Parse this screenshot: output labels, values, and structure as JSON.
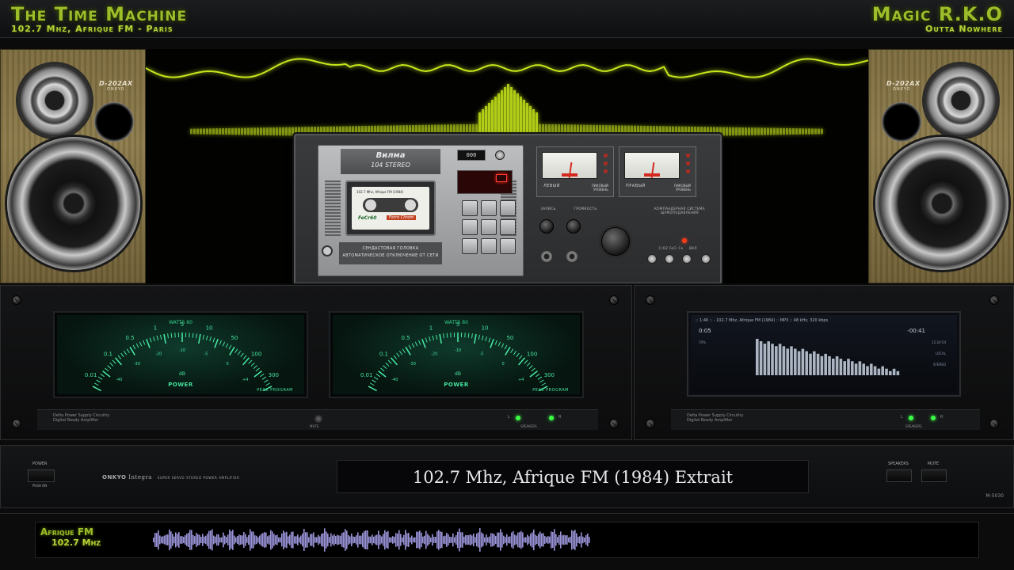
{
  "header": {
    "title_left": "The Time Machine",
    "subtitle_left": "102.7 Mhz, Afrique FM - Paris",
    "title_right": "Magic R.K.O",
    "subtitle_right": "Outta Nowhere"
  },
  "speakers": {
    "model": "D-202AX",
    "maker": "ONKYO"
  },
  "cassette_deck": {
    "brand": "Вилма",
    "model": "104 STEREO",
    "counter": "000",
    "cassette_title": "102.7 Mhz, Afrique FM (1984)",
    "cassette_type": "FeCr60",
    "cassette_label": "Ferro Chrom",
    "caption_line1": "СЕНДАСТОВАЯ ГОЛОВКА",
    "caption_line2": "АВТОМАТИЧЕСКОЕ ОТКЛЮЧЕНИЕ ОТ СЕТИ",
    "vu_left_label": "ЛЕВЫЙ",
    "vu_right_label": "ПРАВЫЙ",
    "vu_peak_label": "ПИКОВЫЙ УРОВЕНЬ",
    "label_record": "ЗАПИСЬ",
    "label_volume": "ГРОМКОСТЬ",
    "label_compander": "КОМПАНДЕРНАЯ СИСТЕМА ШУМОПОДАВЛЕНИЯ",
    "label_tape_types": "CrO2  FeCr  Fe",
    "label_on": "ВКЛ"
  },
  "amp_meters": {
    "watts_label": "WATTS 80",
    "power_label": "POWER",
    "peak_label": "PEAK PROGRAM",
    "db_label": "dB",
    "scale_top": [
      "0.01",
      "0.1",
      "0.5",
      "1",
      "5",
      "10",
      "50",
      "100",
      "300"
    ],
    "scale_bottom": [
      "-40",
      "-30",
      "-20",
      "-10",
      "-5",
      "0",
      "+4"
    ]
  },
  "amp_footer": {
    "line1": "Delta Power Supply Circuitry",
    "line2": "Digital Ready Amplifier",
    "mute": "MUTE",
    "speakers": "SPEAKERS",
    "left": "L",
    "right": "R"
  },
  "player": {
    "top_line": ":: 1:46 :: - 102.7 Mhz, Afrique FM (1984) :: MP3 :: 48 kHz, 320 kbps",
    "elapsed": "0:05",
    "remaining": "-00:41",
    "clock": "12:24:54",
    "volume": "70%",
    "mode1": "LOCAL",
    "mode2": "STEREO"
  },
  "amp_strip": {
    "power": "POWER",
    "push_on": "PUSH ON",
    "brand": "ONKYO",
    "line": "Integra",
    "description": "SUPER SERVO STEREO POWER AMPLIFIER",
    "display_text": "102.7 Mhz, Afrique FM (1984) Extrait",
    "speakers": "SPEAKERS",
    "mute": "MUTE",
    "model": "M-5030"
  },
  "waveform": {
    "station": "Afrique FM",
    "frequency": "102.7 Mhz",
    "played_fraction": 0.53
  },
  "colors": {
    "accent_green": "#9dbd2a",
    "meter_green": "#46e3a0",
    "waveform": "#9a94d8",
    "led_green": "#3cff46"
  }
}
